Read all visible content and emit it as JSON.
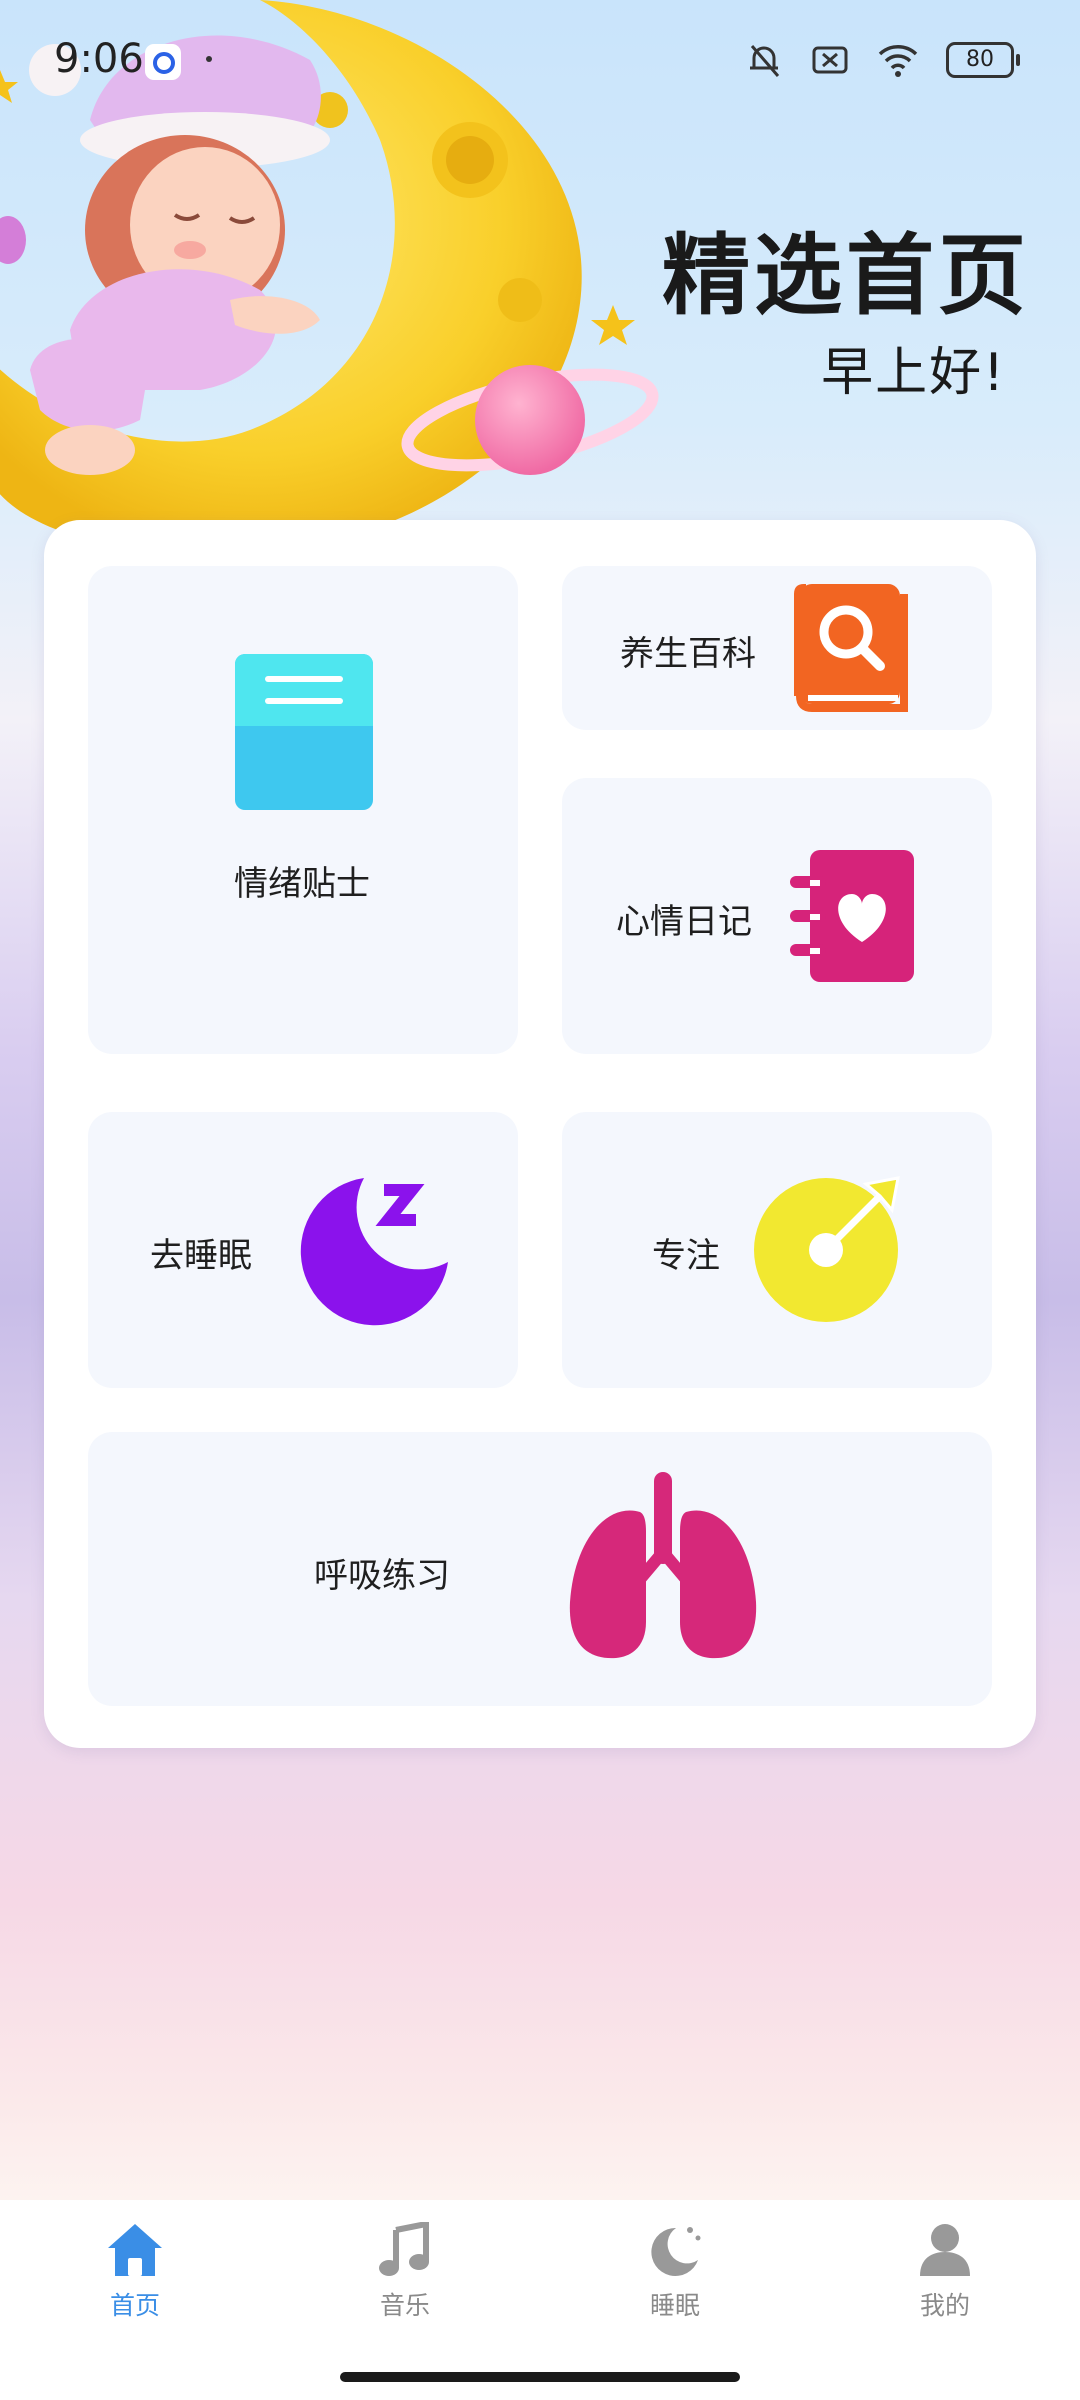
{
  "status_bar": {
    "time": "9:06",
    "battery": "80"
  },
  "hero": {
    "title": "精选首页",
    "subtitle": "早上好!"
  },
  "tiles": [
    {
      "label": "情绪贴士",
      "icon": "notebook-icon",
      "color": "#3ecdf0"
    },
    {
      "label": "养生百科",
      "icon": "book-search-icon",
      "color": "#f26522"
    },
    {
      "label": "心情日记",
      "icon": "heart-diary-icon",
      "color": "#d6237a"
    },
    {
      "label": "去睡眠",
      "icon": "moon-sleep-icon",
      "color": "#8b12ec"
    },
    {
      "label": "专注",
      "icon": "focus-disc-icon",
      "color": "#f2e830"
    },
    {
      "label": "呼吸练习",
      "icon": "lungs-icon",
      "color": "#d6287a"
    }
  ],
  "nav": {
    "active_color": "#3a8ee6",
    "items": [
      {
        "label": "首页",
        "icon": "home-icon",
        "active": true
      },
      {
        "label": "音乐",
        "icon": "music-note-icon",
        "active": false
      },
      {
        "label": "睡眠",
        "icon": "moon-icon",
        "active": false
      },
      {
        "label": "我的",
        "icon": "user-icon",
        "active": false
      }
    ]
  }
}
